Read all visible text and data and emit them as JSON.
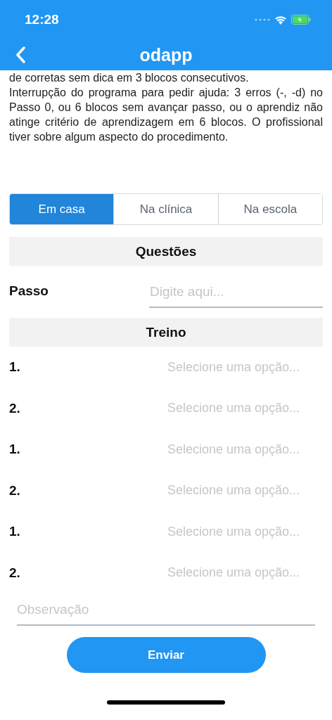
{
  "status_bar": {
    "time": "12:28"
  },
  "header": {
    "title": "odapp"
  },
  "paragraphs": [
    "de corretas sem dica em 3 blocos consecutivos.",
    "Interrupção do programa para pedir ajuda: 3 erros (-, -d) no Passo 0, ou 6 blocos sem avançar passo, ou o aprendiz não atinge critério de aprendizagem em 6 blocos. O profissional tiver sobre algum aspecto do procedimento."
  ],
  "tabs": [
    {
      "label": "Em casa",
      "selected": true
    },
    {
      "label": "Na clínica",
      "selected": false
    },
    {
      "label": "Na escola",
      "selected": false
    }
  ],
  "questions_section": {
    "title": "Questões"
  },
  "step_field": {
    "label": "Passo",
    "placeholder": "Digite aqui..."
  },
  "training_section": {
    "title": "Treino"
  },
  "training_rows": [
    {
      "number": "1.",
      "placeholder": "Selecione uma opção..."
    },
    {
      "number": "2.",
      "placeholder": "Selecione uma opção..."
    },
    {
      "number": "1.",
      "placeholder": "Selecione uma opção..."
    },
    {
      "number": "2.",
      "placeholder": "Selecione uma opção..."
    },
    {
      "number": "1.",
      "placeholder": "Selecione uma opção..."
    },
    {
      "number": "2.",
      "placeholder": "Selecione uma opção..."
    }
  ],
  "observation": {
    "placeholder": "Observação"
  },
  "submit_button": {
    "label": "Enviar"
  }
}
